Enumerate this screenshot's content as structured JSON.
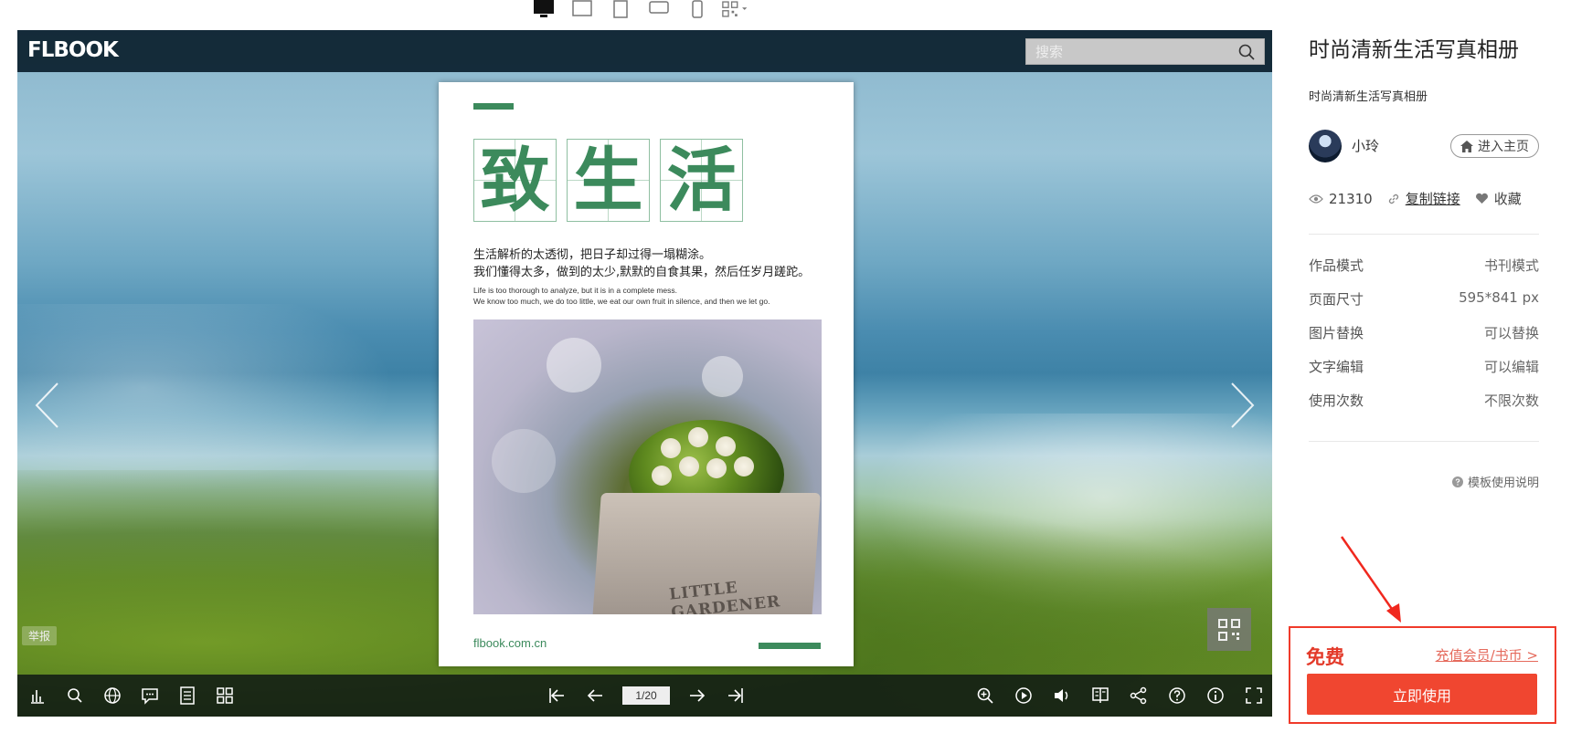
{
  "device_bar": {
    "items": [
      "desktop-icon",
      "tablet-landscape-icon",
      "tablet-portrait-icon",
      "phone-landscape-icon",
      "phone-portrait-icon",
      "qrcode-dropdown-icon"
    ]
  },
  "viewer": {
    "logo": "FLBOOK",
    "search_placeholder": "搜索",
    "report_label": "举报",
    "page_indicator": "1/20",
    "page": {
      "title_chars": [
        "致",
        "生",
        "活"
      ],
      "cn_line1": "生活解析的太透彻，把日子却过得一塌糊涂。",
      "cn_line2": "我们懂得太多，做到的太少,默默的自食其果，然后任岁月蹉跎。",
      "en_line1": "Life is too thorough to analyze, but it is in a complete mess.",
      "en_line2": "We know too much, we do too little, we eat our own fruit in silence, and then we let go.",
      "photo_label": "LITTLE GARDENER",
      "site": "flbook.com.cn"
    },
    "colors": {
      "accent_green": "#3c8a5c"
    }
  },
  "sidebar": {
    "title": "时尚清新生活写真相册",
    "subtitle": "时尚清新生活写真相册",
    "author_name": "小玲",
    "home_button": "进入主页",
    "views": "21310",
    "copy_link": "复制链接",
    "favorite": "收藏",
    "properties": [
      {
        "label": "作品模式",
        "value": "书刊模式"
      },
      {
        "label": "页面尺寸",
        "value": "595*841 px"
      },
      {
        "label": "图片替换",
        "value": "可以替换"
      },
      {
        "label": "文字编辑",
        "value": "可以编辑"
      },
      {
        "label": "使用次数",
        "value": "不限次数"
      }
    ],
    "help": "模板使用说明",
    "price": "免费",
    "recharge": "充值会员/书币 >",
    "use_button": "立即使用",
    "colors": {
      "price_red": "#e33a2a",
      "button_red": "#f04630"
    }
  }
}
